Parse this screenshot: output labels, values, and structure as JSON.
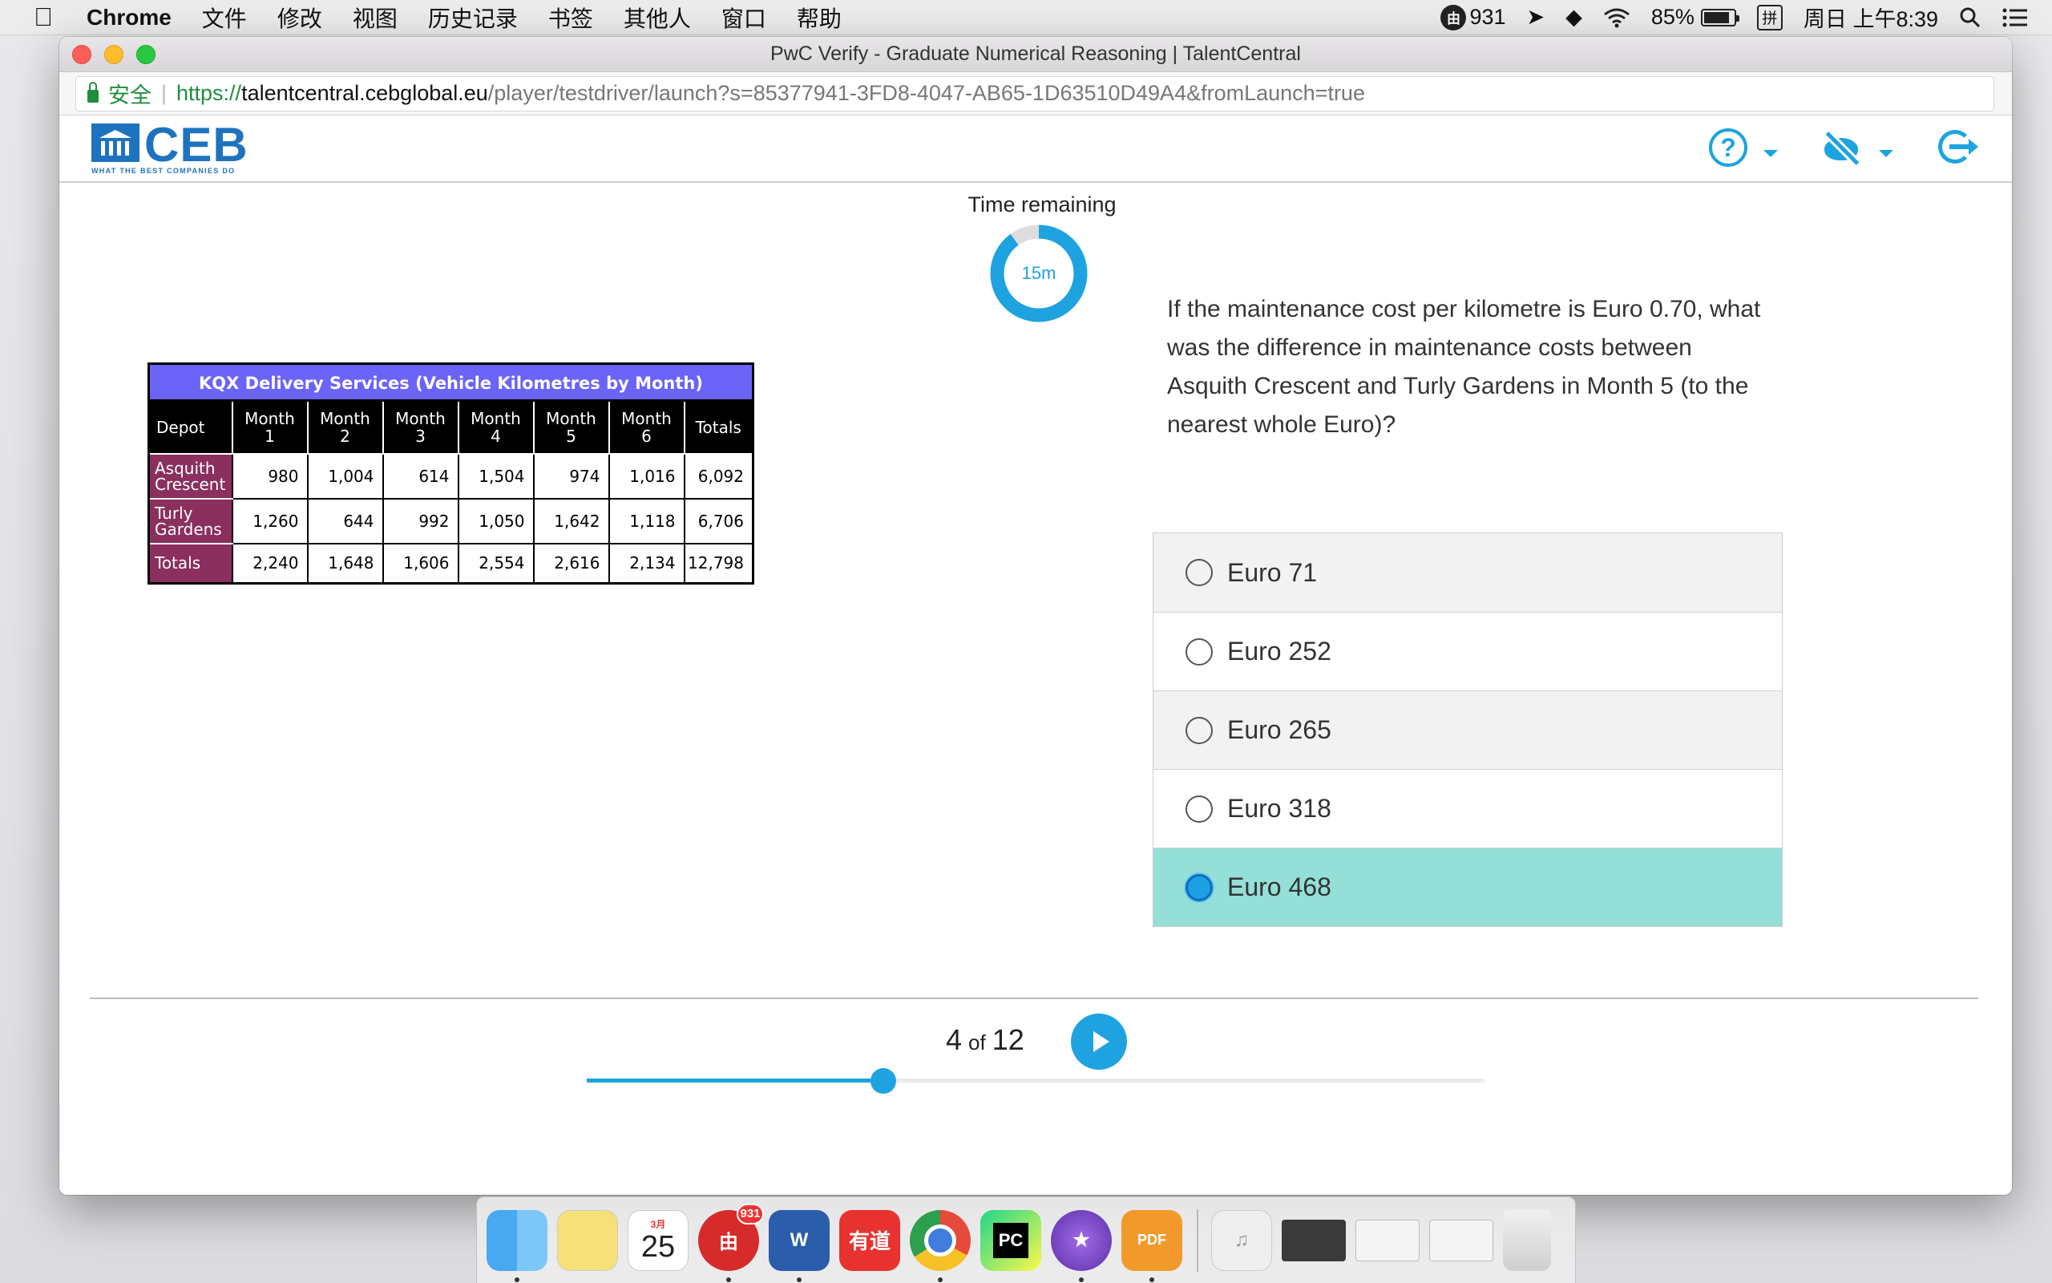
{
  "menubar": {
    "app_name": "Chrome",
    "menus": [
      "文件",
      "修改",
      "视图",
      "历史记录",
      "书签",
      "其他人",
      "窗口",
      "帮助"
    ],
    "notif_badge_icon": "由",
    "notif_count": "931",
    "battery_percent": "85%",
    "battery_level": 0.85,
    "input_method": "拼",
    "clock": "周日 上午8:39"
  },
  "browser": {
    "window_title": "PwC Verify - Graduate Numerical Reasoning | TalentCentral",
    "secure_label": "安全",
    "url_scheme": "https://",
    "url_host": "talentcentral.cebglobal.eu",
    "url_path": "/player/testdriver/launch?s=85377941-3FD8-4047-AB65-1D63510D49A4&fromLaunch=true"
  },
  "header": {
    "logo_text": "CEB",
    "logo_tagline": "WHAT THE BEST COMPANIES DO",
    "icons": [
      "help-icon",
      "accessibility-icon",
      "exit-icon"
    ],
    "accent_color": "#1ea3e0"
  },
  "timer": {
    "label": "Time remaining",
    "value": "15m",
    "remaining_fraction": 0.9
  },
  "table": {
    "title": "KQX Delivery Services (Vehicle Kilometres by Month)",
    "columns": [
      "Depot",
      "Month 1",
      "Month 2",
      "Month 3",
      "Month 4",
      "Month 5",
      "Month 6",
      "Totals"
    ],
    "rows": [
      {
        "depot": "Asquith Crescent",
        "values": [
          "980",
          "1,004",
          "614",
          "1,504",
          "974",
          "1,016",
          "6,092"
        ]
      },
      {
        "depot": "Turly Gardens",
        "values": [
          "1,260",
          "644",
          "992",
          "1,050",
          "1,642",
          "1,118",
          "6,706"
        ]
      },
      {
        "depot": "Totals",
        "values": [
          "2,240",
          "1,648",
          "1,606",
          "2,554",
          "2,616",
          "2,134",
          "12,798"
        ]
      }
    ],
    "title_color": "#6c63f8",
    "row_header_color": "#8a2f5e"
  },
  "question": {
    "text": "If the maintenance cost per kilometre is Euro 0.70, what was the difference in maintenance costs between Asquith Crescent and Turly Gardens in Month 5 (to the nearest whole Euro)?",
    "options": [
      {
        "label": "Euro 71",
        "selected": false
      },
      {
        "label": "Euro 252",
        "selected": false
      },
      {
        "label": "Euro 265",
        "selected": false
      },
      {
        "label": "Euro 318",
        "selected": false
      },
      {
        "label": "Euro 468",
        "selected": true
      }
    ],
    "selected_color": "#94dfd8"
  },
  "navigation": {
    "current": "4",
    "of": "of",
    "total": "12",
    "progress_fraction": 0.33
  },
  "dock": {
    "apps": [
      "finder-icon",
      "notes-icon",
      "calendar-icon",
      "app-icon",
      "word-icon",
      "youdao-icon",
      "chrome-icon",
      "pycharm-icon",
      "imovie-icon",
      "pdf-icon",
      "music-icon",
      "window-thumbnail",
      "window-thumbnail",
      "window-thumbnail",
      "trash-icon"
    ],
    "calendar_month": "3月",
    "calendar_day": "25",
    "app_badge": "931",
    "word_letter": "W",
    "youdao_label": "有道",
    "pycharm_label": "PC",
    "pdf_label": "PDF"
  }
}
